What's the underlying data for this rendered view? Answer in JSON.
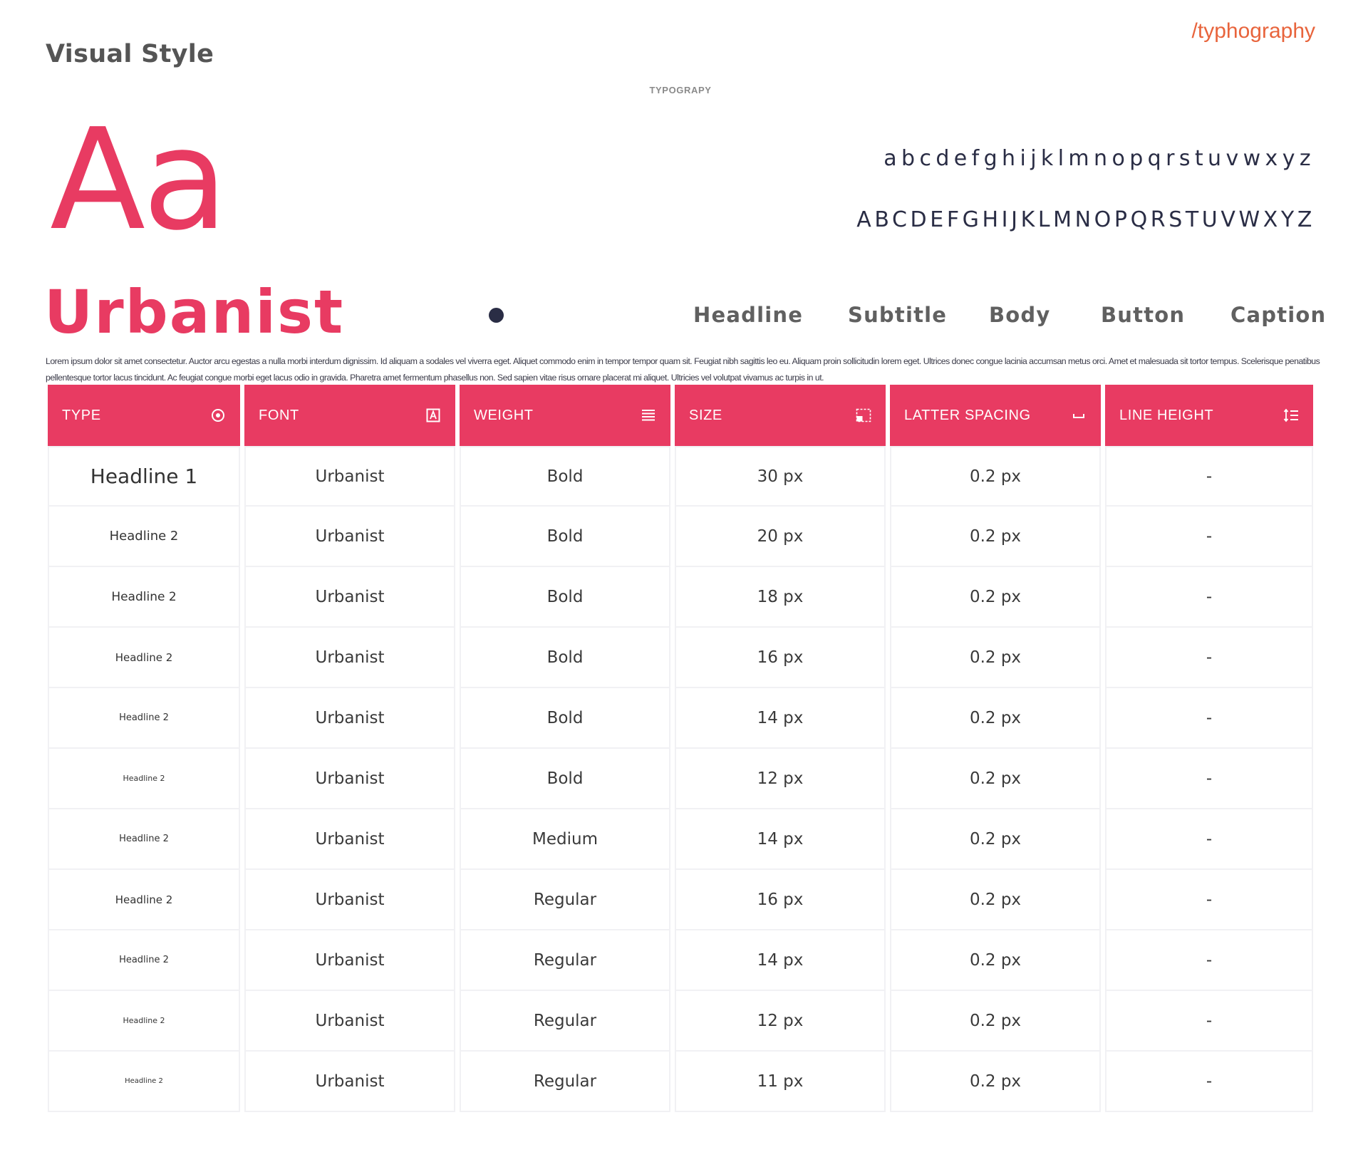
{
  "header": {
    "title": "Visual Style",
    "section_link": "/typhography",
    "caption": "TYPOGRAPY"
  },
  "specimen": {
    "aa": "Aa",
    "lowercase": "abcdefghijklmnopqrstuvwxyz",
    "uppercase": "ABCDEFGHIJKLMNOPQRSTUVWXYZ",
    "font_name": "Urbanist",
    "lorem": "Lorem ipsum dolor sit amet consectetur. Auctor arcu egestas a nulla morbi interdum dignissim. Id aliquam a sodales vel viverra eget. Aliquet commodo enim in tempor tempor quam sit. Feugiat nibh sagittis leo eu. Aliquam proin sollicitudin lorem eget. Ultrices donec congue lacinia accumsan metus orci. Amet et malesuada sit tortor tempus. Scelerisque penatibus pellentesque tortor lacus tincidunt. Ac feugiat congue morbi eget lacus odio in gravida. Pharetra amet fermentum phasellus non. Sed sapien vitae risus ornare placerat mi aliquet. Ultricies vel volutpat vivamus ac turpis in ut."
  },
  "style_tabs": [
    "Headline",
    "Subtitle",
    "Body",
    "Button",
    "Caption"
  ],
  "colors": {
    "accent": "#e83b62",
    "dark": "#2a2d45",
    "link": "#e8643c"
  },
  "table": {
    "columns": [
      {
        "label": "TYPE",
        "icon": "target-icon"
      },
      {
        "label": "FONT",
        "icon": "font-box-icon"
      },
      {
        "label": "WEIGHT",
        "icon": "lines-icon"
      },
      {
        "label": "SIZE",
        "icon": "resize-icon"
      },
      {
        "label": "LATTER SPACING",
        "icon": "space-bar-icon"
      },
      {
        "label": "LINE HEIGHT",
        "icon": "line-height-icon"
      }
    ],
    "rows": [
      {
        "type": "Headline 1",
        "font": "Urbanist",
        "weight": "Bold",
        "size": "30 px",
        "spacing": "0.2 px",
        "line_height": "-"
      },
      {
        "type": "Headline 2",
        "font": "Urbanist",
        "weight": "Bold",
        "size": "20 px",
        "spacing": "0.2 px",
        "line_height": "-"
      },
      {
        "type": "Headline 2",
        "font": "Urbanist",
        "weight": "Bold",
        "size": "18 px",
        "spacing": "0.2 px",
        "line_height": "-"
      },
      {
        "type": "Headline 2",
        "font": "Urbanist",
        "weight": "Bold",
        "size": "16 px",
        "spacing": "0.2 px",
        "line_height": "-"
      },
      {
        "type": "Headline 2",
        "font": "Urbanist",
        "weight": "Bold",
        "size": "14 px",
        "spacing": "0.2 px",
        "line_height": "-"
      },
      {
        "type": "Headline 2",
        "font": "Urbanist",
        "weight": "Bold",
        "size": "12 px",
        "spacing": "0.2 px",
        "line_height": "-"
      },
      {
        "type": "Headline 2",
        "font": "Urbanist",
        "weight": "Medium",
        "size": "14 px",
        "spacing": "0.2 px",
        "line_height": "-"
      },
      {
        "type": "Headline 2",
        "font": "Urbanist",
        "weight": "Regular",
        "size": "16 px",
        "spacing": "0.2 px",
        "line_height": "-"
      },
      {
        "type": "Headline 2",
        "font": "Urbanist",
        "weight": "Regular",
        "size": "14 px",
        "spacing": "0.2 px",
        "line_height": "-"
      },
      {
        "type": "Headline 2",
        "font": "Urbanist",
        "weight": "Regular",
        "size": "12 px",
        "spacing": "0.2 px",
        "line_height": "-"
      },
      {
        "type": "Headline 2",
        "font": "Urbanist",
        "weight": "Regular",
        "size": "11 px",
        "spacing": "0.2 px",
        "line_height": "-"
      }
    ]
  }
}
